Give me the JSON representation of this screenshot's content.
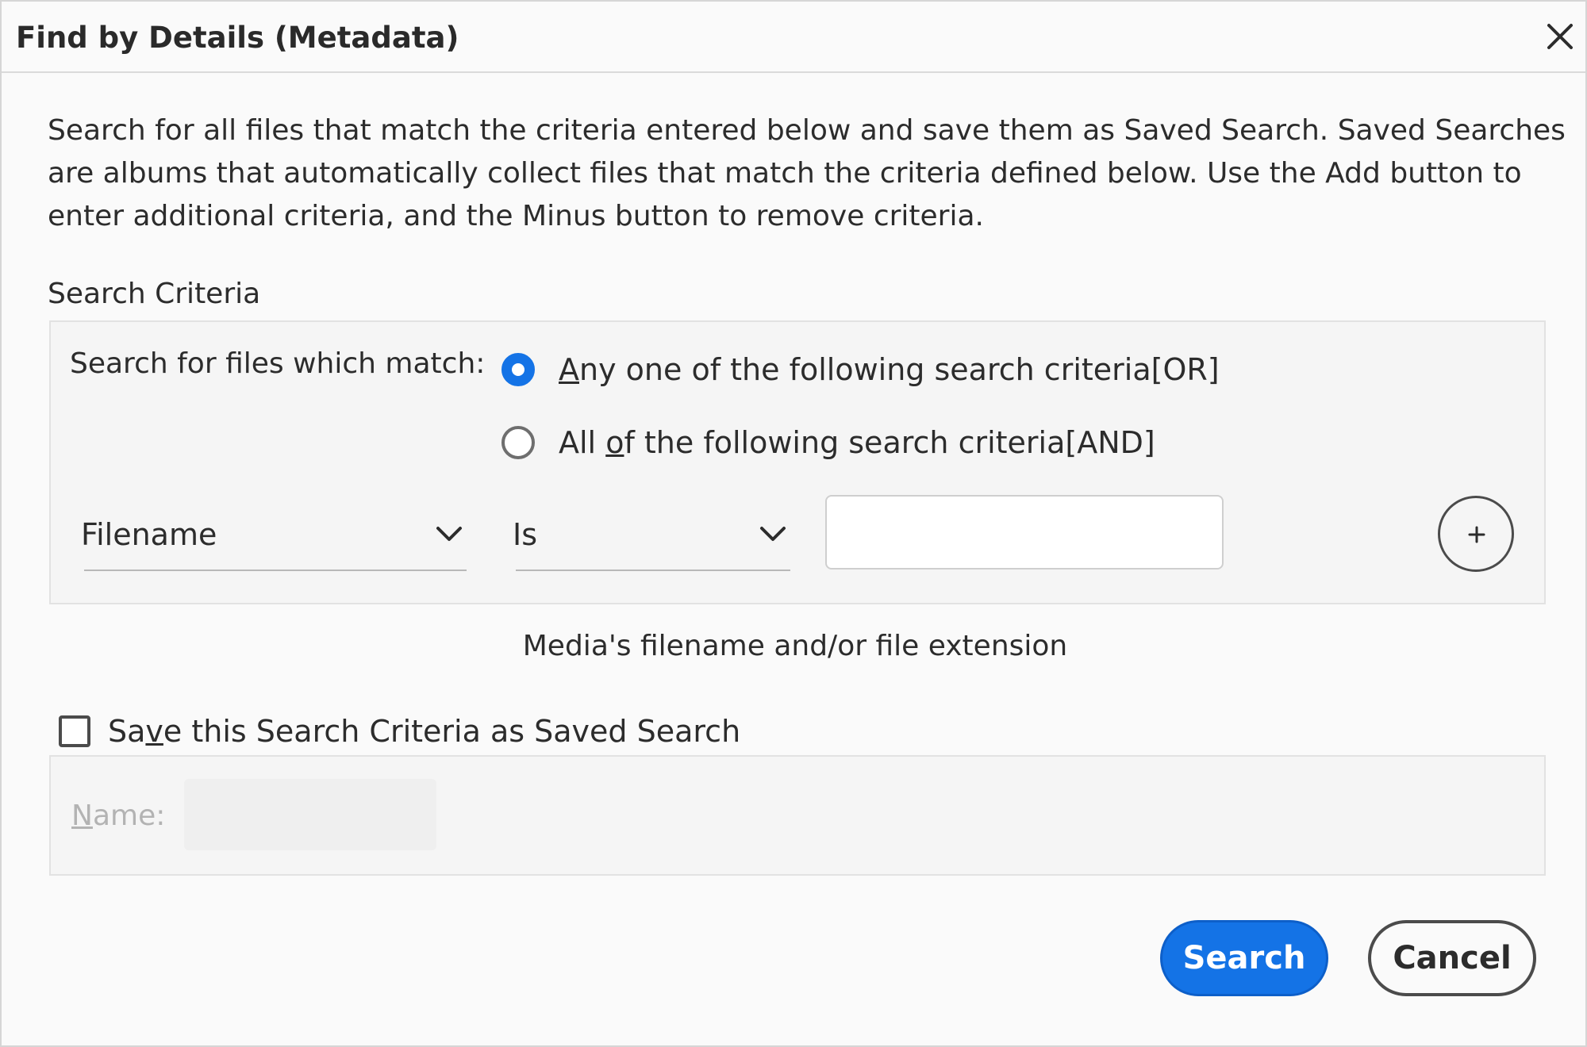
{
  "dialog": {
    "title": "Find by Details (Metadata)",
    "close_icon": "close-icon"
  },
  "description": {
    "lines": [
      "Search for all files that match the criteria entered below and save them as Saved Search. Saved Searches",
      "are albums that automatically collect files that match the criteria defined below. Use the Add button to",
      "enter additional criteria, and the Minus button to remove criteria."
    ]
  },
  "criteria": {
    "section_label": "Search Criteria",
    "match_label": "Search for files which match:",
    "options": [
      {
        "pre": "",
        "accel": "A",
        "post": "ny one of the following search criteria[OR]",
        "selected": true
      },
      {
        "pre": "All ",
        "accel": "o",
        "post": "f the following search criteria[AND]",
        "selected": false
      }
    ],
    "row": {
      "field": "Filename",
      "operator": "Is",
      "value": "",
      "add_icon": "plus-icon",
      "dropdown_icon": "chevron-down-icon"
    },
    "hint": "Media's filename and/or file extension"
  },
  "save_search": {
    "checked": false,
    "pre": "Sa",
    "accel": "v",
    "post": "e this Search Criteria as Saved Search",
    "name_label_accel": "N",
    "name_label_rest": "ame:",
    "name_value": ""
  },
  "buttons": {
    "search": "Search",
    "cancel": "Cancel"
  },
  "colors": {
    "accent": "#1473e6",
    "background": "#fafafa",
    "disabled_text": "#b3b3b3"
  }
}
